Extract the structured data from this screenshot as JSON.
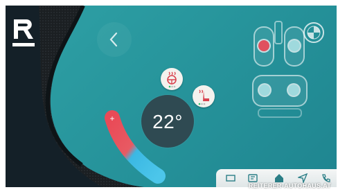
{
  "climate": {
    "temperature": "22°",
    "increase_symbol": "+"
  },
  "branding": {
    "logo_letter": "R",
    "watermark": "REITERER-AUTOHAUS.AT",
    "car_brand_logo": "bmw-roundel"
  },
  "icons": {
    "back": "chevron-left-icon",
    "heated_steering": "heated-steering-wheel-icon",
    "heated_seat": "heated-seat-icon",
    "dock": [
      "apps-icon",
      "media-icon",
      "home-icon",
      "navigation-icon",
      "phone-icon"
    ]
  },
  "colors": {
    "screen": "#2a9ba1",
    "dial": "#2f4a52",
    "warm": "#e94a57",
    "cool": "#3bb8e3",
    "active_seat": "#e0515e"
  }
}
